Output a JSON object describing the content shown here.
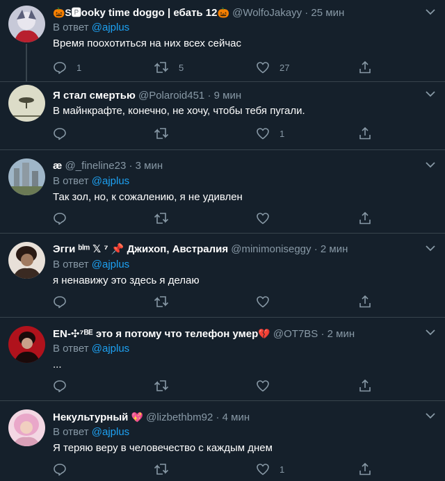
{
  "tweets": [
    {
      "name_prefix": "🎃S🅿",
      "name": "ooky time doggo | ебать 12",
      "name_suffix": "🎃",
      "handle": "@WolfoJakayy",
      "sep": "·",
      "time": "25 мин",
      "reply_prefix": "В ответ",
      "reply_to": "@ajplus",
      "text": "Время поохотиться на них всех сейчас",
      "replies": "1",
      "retweets": "5",
      "likes": "27",
      "avatar_colors": [
        "#c7c9d8",
        "#b8202e"
      ]
    },
    {
      "name": "Я стал смертью",
      "handle": "@Polaroid451",
      "sep": "·",
      "time": "9 мин",
      "text": "В майнкрафте, конечно, не хочу, чтобы тебя пугали.",
      "replies": "",
      "retweets": "",
      "likes": "1",
      "avatar_colors": [
        "#dcdcc8",
        "#4a4a3a"
      ]
    },
    {
      "name": "æ",
      "handle": "@_fineline23",
      "sep": "·",
      "time": "3 мин",
      "reply_prefix": "В ответ",
      "reply_to": "@ajplus",
      "text": "Так зол, но, к сожалению, я не удивлен",
      "replies": "",
      "retweets": "",
      "likes": "",
      "avatar_colors": [
        "#9fb6c8",
        "#6b7a55"
      ]
    },
    {
      "name": "Эгги ᵇˡᵐ 𝕏 ⁷ 📌 Джихоп, Австралия",
      "handle": "@minimoniseggy",
      "sep": "·",
      "time": "2 мин",
      "reply_prefix": "В ответ",
      "reply_to": "@ajplus",
      "text": "я ненавижу это здесь я делаю",
      "replies": "",
      "retweets": "",
      "likes": "",
      "avatar_colors": [
        "#e8e0d8",
        "#2a1a14"
      ]
    },
    {
      "name": "EN-✣⁷ᴮᴱ это я потому что телефон умер",
      "name_suffix": "💔",
      "handle": "@OT7BS",
      "sep": "·",
      "time": "2 мин",
      "reply_prefix": "В ответ",
      "reply_to": "@ajplus",
      "text": "...",
      "replies": "",
      "retweets": "",
      "likes": "",
      "avatar_colors": [
        "#b0121c",
        "#1a0a0a"
      ]
    },
    {
      "name": "Некультурный",
      "name_suffix": "💖",
      "handle": "@lizbethbm92",
      "sep": "·",
      "time": "4 мин",
      "reply_prefix": "В ответ",
      "reply_to": "@ajplus",
      "text": "Я теряю веру в человечество с каждым днем",
      "replies": "",
      "retweets": "",
      "likes": "1",
      "avatar_colors": [
        "#e9a7c9",
        "#f3d7e3"
      ]
    }
  ],
  "colors": {
    "background": "#15202b",
    "border": "#38444d",
    "secondary_text": "#8899a6",
    "link": "#1da1f2"
  },
  "icons": [
    "reply-icon",
    "retweet-icon",
    "like-icon",
    "share-icon",
    "chevron-down-icon"
  ]
}
